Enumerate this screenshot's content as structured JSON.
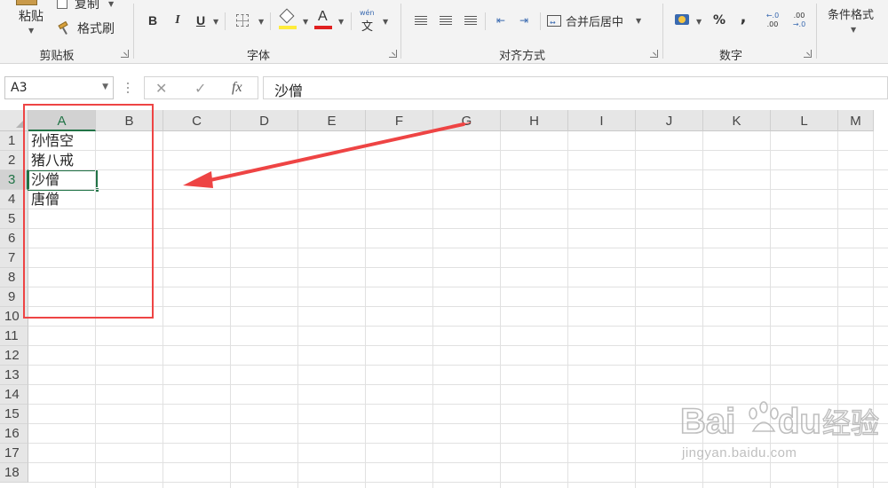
{
  "ribbon": {
    "clipboard": {
      "paste_label": "粘贴",
      "copy_label": "复制",
      "format_painter_label": "格式刷",
      "group_label": "剪贴板"
    },
    "font": {
      "bold": "B",
      "italic": "I",
      "underline": "U",
      "font_color_glyph": "A",
      "wen_top": "wén",
      "wen_bottom": "文",
      "group_label": "字体",
      "fill_color": "#ffeb3b",
      "font_color": "#e02020"
    },
    "alignment": {
      "merge_label": "合并后居中",
      "group_label": "对齐方式"
    },
    "number": {
      "percent": "%",
      "comma": ",",
      "inc_top": "←.0",
      "inc_bottom": ".00",
      "dec_top": ".00",
      "dec_bottom": "→.0",
      "group_label": "数字"
    },
    "styles": {
      "conditional_label": "条件格式"
    }
  },
  "formula_bar": {
    "name_box": "A3",
    "cancel_icon": "✕",
    "enter_icon": "✓",
    "fx_label": "fx",
    "value": "沙僧"
  },
  "sheet": {
    "columns": [
      "A",
      "B",
      "C",
      "D",
      "E",
      "F",
      "G",
      "H",
      "I",
      "J",
      "K",
      "L",
      "M"
    ],
    "rows": [
      "1",
      "2",
      "3",
      "4",
      "5",
      "6",
      "7",
      "8",
      "9",
      "10",
      "11",
      "12",
      "13",
      "14",
      "15",
      "16",
      "17",
      "18"
    ],
    "active_cell": "A3",
    "cells": {
      "A1": "孙悟空",
      "A2": "猪八戒",
      "A3": "沙僧",
      "A4": "唐僧"
    },
    "accent_color": "#217346"
  },
  "annotation": {
    "color": "#ee4444"
  },
  "watermark": {
    "logo_text": "Bai du 经验",
    "url_text": "jingyan.baidu.com"
  }
}
